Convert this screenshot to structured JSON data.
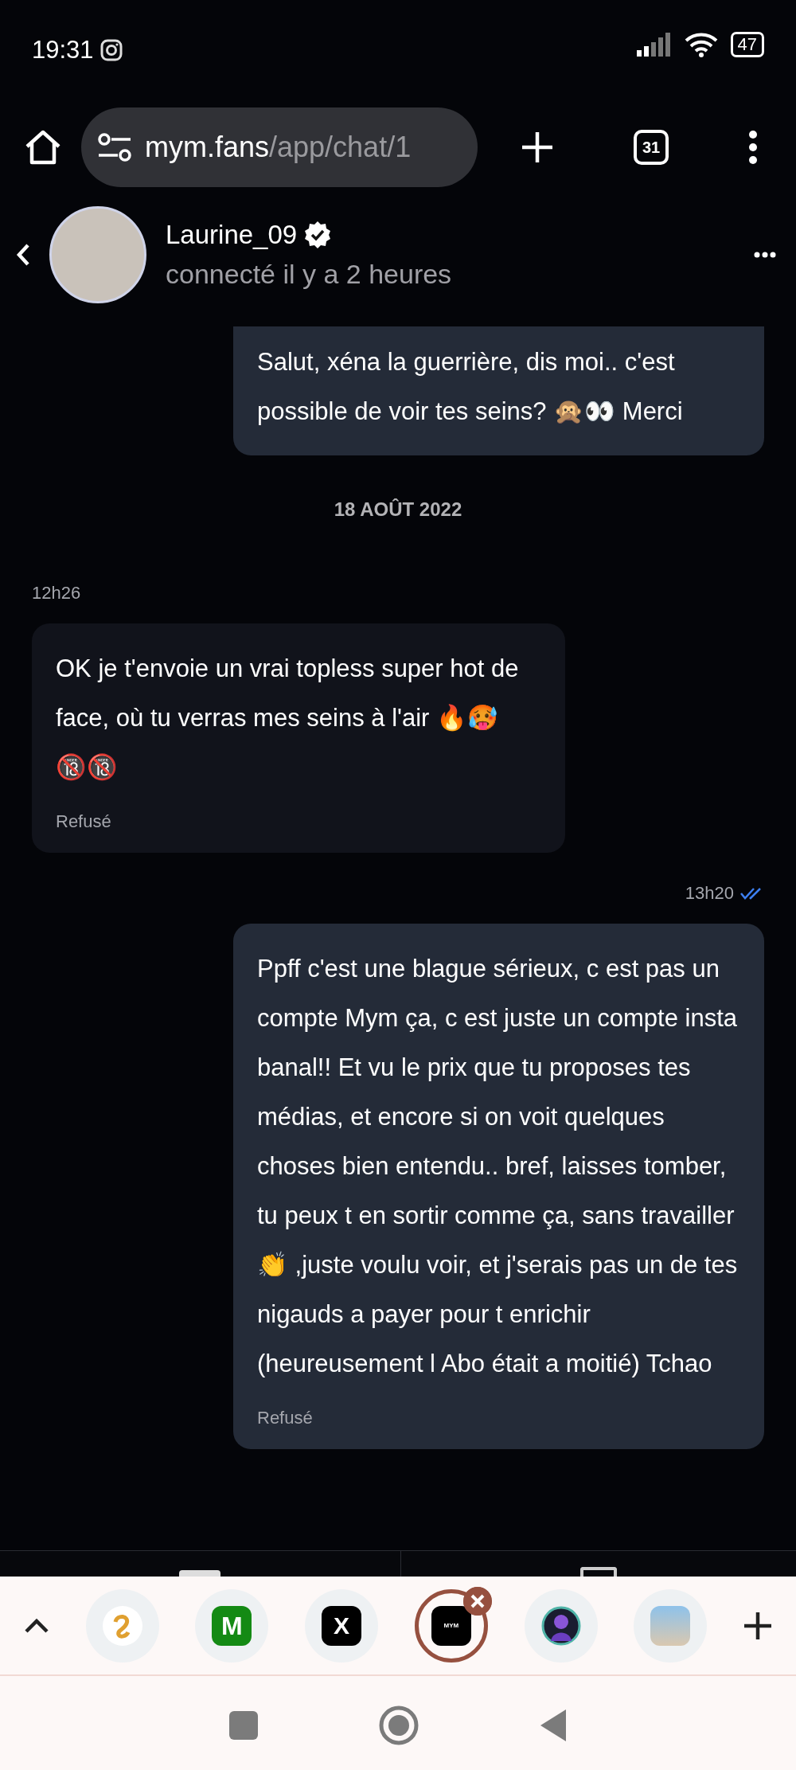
{
  "status_bar": {
    "time": "19:31",
    "battery": "47"
  },
  "browser": {
    "url_host": "mym.fans",
    "url_path": "/app/chat/1",
    "tab_count": "31"
  },
  "chat_header": {
    "name": "Laurine_09",
    "verified": true,
    "presence": "connecté il y a 2 heures"
  },
  "messages": [
    {
      "kind": "outgoing",
      "cut_top": true,
      "text": "Salut, xéna la guerrière, dis moi.. c'est possible de voir tes seins? 🙊👀 Merci"
    },
    {
      "kind": "date",
      "text": "18 AOÛT 2022"
    },
    {
      "kind": "incoming",
      "time": "12h26",
      "text": "OK je t'envoie un vrai topless super hot de face, où tu verras mes seins à l'air 🔥🥵🔞🔞",
      "status": "Refusé"
    },
    {
      "kind": "outgoing",
      "time": "13h20",
      "read": true,
      "text": "Ppff c'est une blague sérieux, c est pas un compte Mym ça, c est juste un compte insta banal!! Et vu le prix que tu proposes tes médias, et encore si on voit quelques choses bien entendu.. bref, laisses tomber, tu peux t en sortir comme ça, sans travailler 👏 ,juste voulu voir, et j'serais pas un de tes nigauds a payer pour t enrichir (heureusement l Abo était a moitié) Tchao",
      "status": "Refusé"
    }
  ],
  "tab_strip": [
    {
      "kind": "swirl",
      "selected": false
    },
    {
      "kind": "letter",
      "label": "M",
      "selected": false
    },
    {
      "kind": "x",
      "label": "X",
      "selected": false
    },
    {
      "kind": "mym",
      "label": "MYM",
      "selected": true
    },
    {
      "kind": "avatar",
      "selected": false
    },
    {
      "kind": "photo",
      "selected": false
    }
  ]
}
